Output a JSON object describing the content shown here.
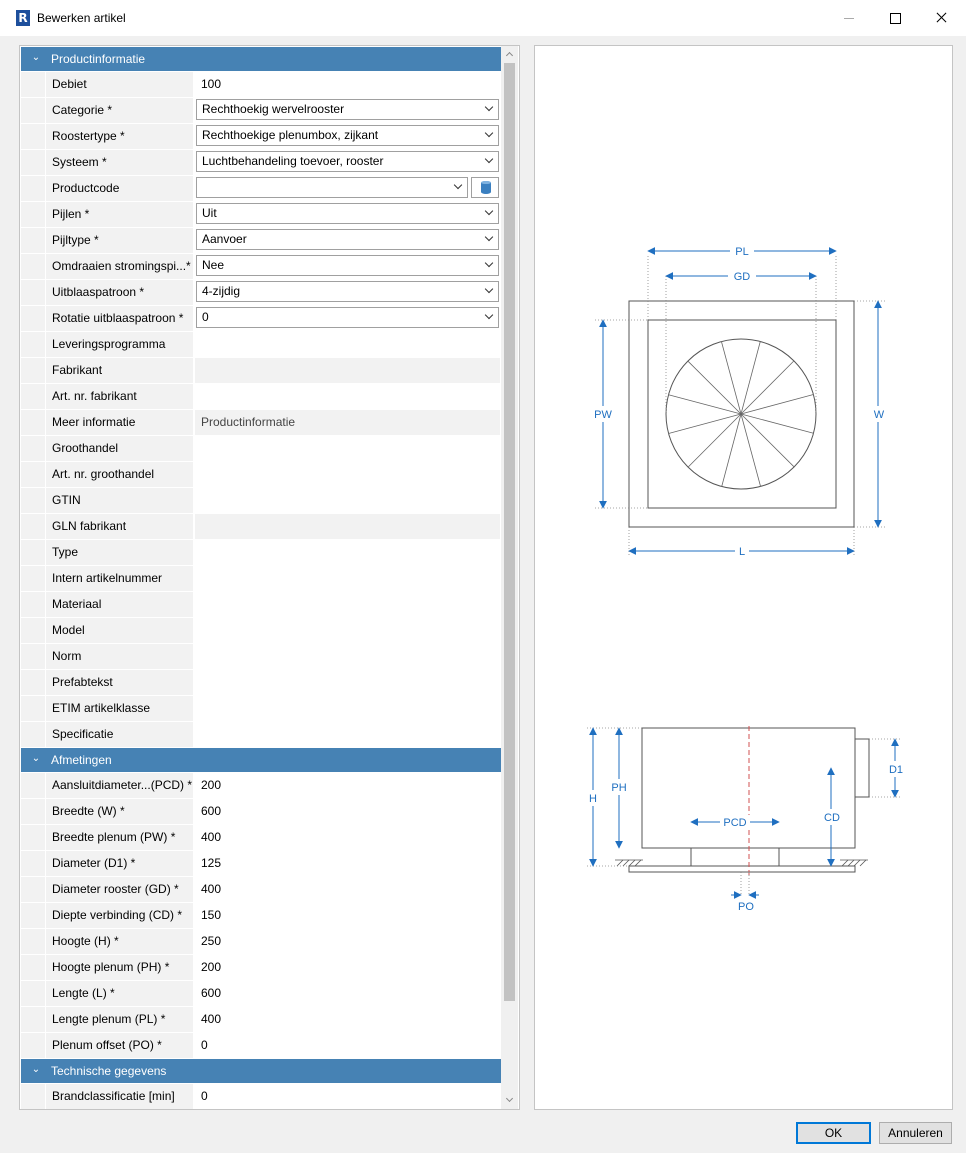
{
  "window": {
    "title": "Bewerken artikel",
    "icon": "revit-icon",
    "app_letter": "R"
  },
  "sections": {
    "productinfo": {
      "label": "Productinformatie",
      "rows": [
        {
          "label": "Debiet",
          "value": "100"
        },
        {
          "label": "Categorie *",
          "value": "Rechthoekig wervelrooster"
        },
        {
          "label": "Roostertype *",
          "value": "Rechthoekige plenumbox, zijkant"
        },
        {
          "label": "Systeem *",
          "value": "Luchtbehandeling toevoer, rooster"
        },
        {
          "label": "Productcode",
          "value": ""
        },
        {
          "label": "Pijlen *",
          "value": "Uit"
        },
        {
          "label": "Pijltype *",
          "value": "Aanvoer"
        },
        {
          "label": "Omdraaien stromingspi...*",
          "value": "Nee"
        },
        {
          "label": "Uitblaaspatroon *",
          "value": "4-zijdig"
        },
        {
          "label": "Rotatie uitblaaspatroon *",
          "value": "0"
        },
        {
          "label": "Leveringsprogramma",
          "value": ""
        },
        {
          "label": "Fabrikant",
          "value": ""
        },
        {
          "label": "Art. nr. fabrikant",
          "value": ""
        },
        {
          "label": "Meer informatie",
          "value": "Productinformatie"
        },
        {
          "label": "Groothandel",
          "value": ""
        },
        {
          "label": "Art. nr. groothandel",
          "value": ""
        },
        {
          "label": "GTIN",
          "value": ""
        },
        {
          "label": "GLN fabrikant",
          "value": ""
        },
        {
          "label": "Type",
          "value": ""
        },
        {
          "label": "Intern artikelnummer",
          "value": ""
        },
        {
          "label": "Materiaal",
          "value": ""
        },
        {
          "label": "Model",
          "value": ""
        },
        {
          "label": "Norm",
          "value": ""
        },
        {
          "label": "Prefabtekst",
          "value": ""
        },
        {
          "label": "ETIM artikelklasse",
          "value": ""
        },
        {
          "label": "Specificatie",
          "value": ""
        }
      ]
    },
    "afmetingen": {
      "label": "Afmetingen",
      "rows": [
        {
          "label": "Aansluitdiameter...(PCD) *",
          "value": "200"
        },
        {
          "label": "Breedte (W) *",
          "value": "600"
        },
        {
          "label": "Breedte plenum (PW) *",
          "value": "400"
        },
        {
          "label": "Diameter (D1) *",
          "value": "125"
        },
        {
          "label": "Diameter rooster (GD) *",
          "value": "400"
        },
        {
          "label": "Diepte verbinding (CD) *",
          "value": "150"
        },
        {
          "label": "Hoogte (H) *",
          "value": "250"
        },
        {
          "label": "Hoogte plenum (PH) *",
          "value": "200"
        },
        {
          "label": "Lengte (L) *",
          "value": "600"
        },
        {
          "label": "Lengte plenum (PL) *",
          "value": "400"
        },
        {
          "label": "Plenum offset (PO) *",
          "value": "0"
        }
      ]
    },
    "technisch": {
      "label": "Technische gegevens",
      "rows": [
        {
          "label": "Brandclassificatie [min]",
          "value": "0"
        }
      ]
    }
  },
  "drawing": {
    "labels": {
      "PL": "PL",
      "GD": "GD",
      "PW": "PW",
      "W": "W",
      "L": "L",
      "H": "H",
      "PH": "PH",
      "PCD": "PCD",
      "CD": "CD",
      "D1": "D1",
      "PO": "PO"
    },
    "color": "#1f6fc0"
  },
  "buttons": {
    "ok": "OK",
    "cancel": "Annuleren"
  }
}
